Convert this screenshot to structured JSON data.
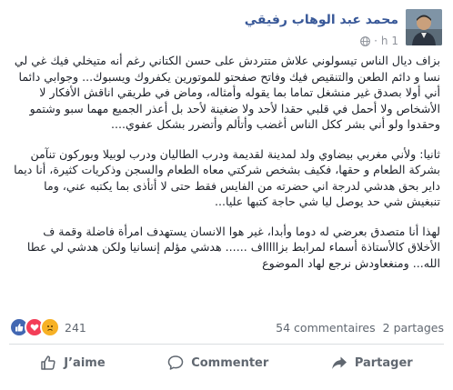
{
  "post": {
    "author": "محمد عبد الوهاب رفيقي",
    "time": "1 h",
    "body": [
      "بزاف ديال الناس تيسولوني علاش متتردش على حسن الكتاني رغم أنه متيخلي فيك غي لي نسا و دائم الطعن والتنقيص فيك وفاتح صفحتو للموتورين يكفروك ويسبوك... وجوابي دائما أني أولا بصدق غير منشغل تماما بما يقوله وأمثاله، وماض في طريقي اناقش الأفكار لا الأشخاص ولا أحمل في قلبي حقدا لأحد ولا ضغينة لأحد بل أعذر الجميع مهما سبو وشتمو وحقدوا ولو أني بشر ككل الناس أغضب وأتألم وأتضرر بشكل عفوي....",
      "ثانيا: ولأني مغربي بيضاوي ولد لمدينة لقديمة ودرب الطاليان ودرب لوبيلا وبوركون تنآمن بشركة الطعام و حقها، فكيف بشخص شركتي معاه الطعام والسجن وذكريات كثيرة، أنا ديما داير بحق هدشي لدرجة اني حضرته من الفايس فقط حتى لا أتأذى بما يكتبه عني، وما تنبغيش شي حد يوصل ليا شي حاجة كتبها عليا...",
      "لهذا أنا متصدق بعرضي له دوما وأبدا، غير هوا الانسان يستهدف امرأة فاضلة وقمة ف الأخلاق كالأستاذة أسماء لمرابط بزاااااف ...... هدشي مؤلم إنسانيا ولكن هدشي لي عطا الله... ومنغعاودش نرجع لهاد الموضوع"
    ]
  },
  "stats": {
    "reaction_count": "241",
    "comments": "54 commentaires",
    "shares": "2 partages"
  },
  "actions": {
    "like": "J’aime",
    "comment": "Commenter",
    "share": "Partager"
  },
  "colors": {
    "author": "#385898",
    "like": "#4267b2",
    "love": "#f33e58",
    "sad": "#f7b125"
  }
}
